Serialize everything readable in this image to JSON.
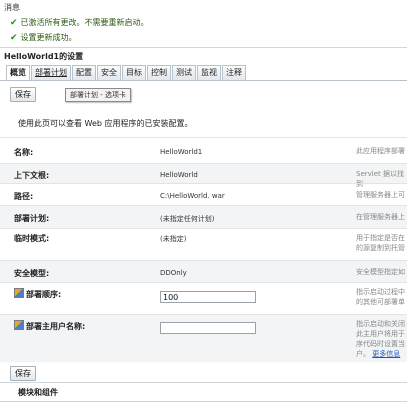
{
  "messages": {
    "title": "消息",
    "items": [
      "已激活所有更改。不需要重新启动。",
      "设置更新成功。"
    ]
  },
  "settings": {
    "title": "HelloWorld1的设置"
  },
  "tabs": [
    "概览",
    "部署计划",
    "配置",
    "安全",
    "目标",
    "控制",
    "测试",
    "监视",
    "注释"
  ],
  "buttons": {
    "save": "保存"
  },
  "tooltip": "部署计划 - 选项卡",
  "description": "使用此页可以查看 Web 应用程序的已安装配置。",
  "rows": [
    {
      "label": "名称:",
      "value": "HelloWorld1",
      "help": "此应用程序部署"
    },
    {
      "label": "上下文根:",
      "value": "HelloWorld",
      "help": "Servlet 据以找到"
    },
    {
      "label": "路径:",
      "value": "C:\\HelloWorld. war",
      "help": "管理服务器上可"
    },
    {
      "label": "部署计划:",
      "value": "(未指定任何计划)",
      "help": "在管理服务器上"
    },
    {
      "label": "临时模式:",
      "value": "(未指定)",
      "help": "用于指定是否在 的源复制到托管"
    },
    {
      "label": "安全模型:",
      "value": "DDOnly",
      "help": "安全模型指定如"
    },
    {
      "label": "部署顺序:",
      "value": "100",
      "help": "指示启动过程中 的其他可部署单"
    },
    {
      "label": "部署主用户名称:",
      "value": "",
      "help": "指示启动和关闭 此主用户将用于 序代码时设置当 户。",
      "more": "更多信息"
    }
  ],
  "modules": {
    "title": "模块和组件"
  }
}
